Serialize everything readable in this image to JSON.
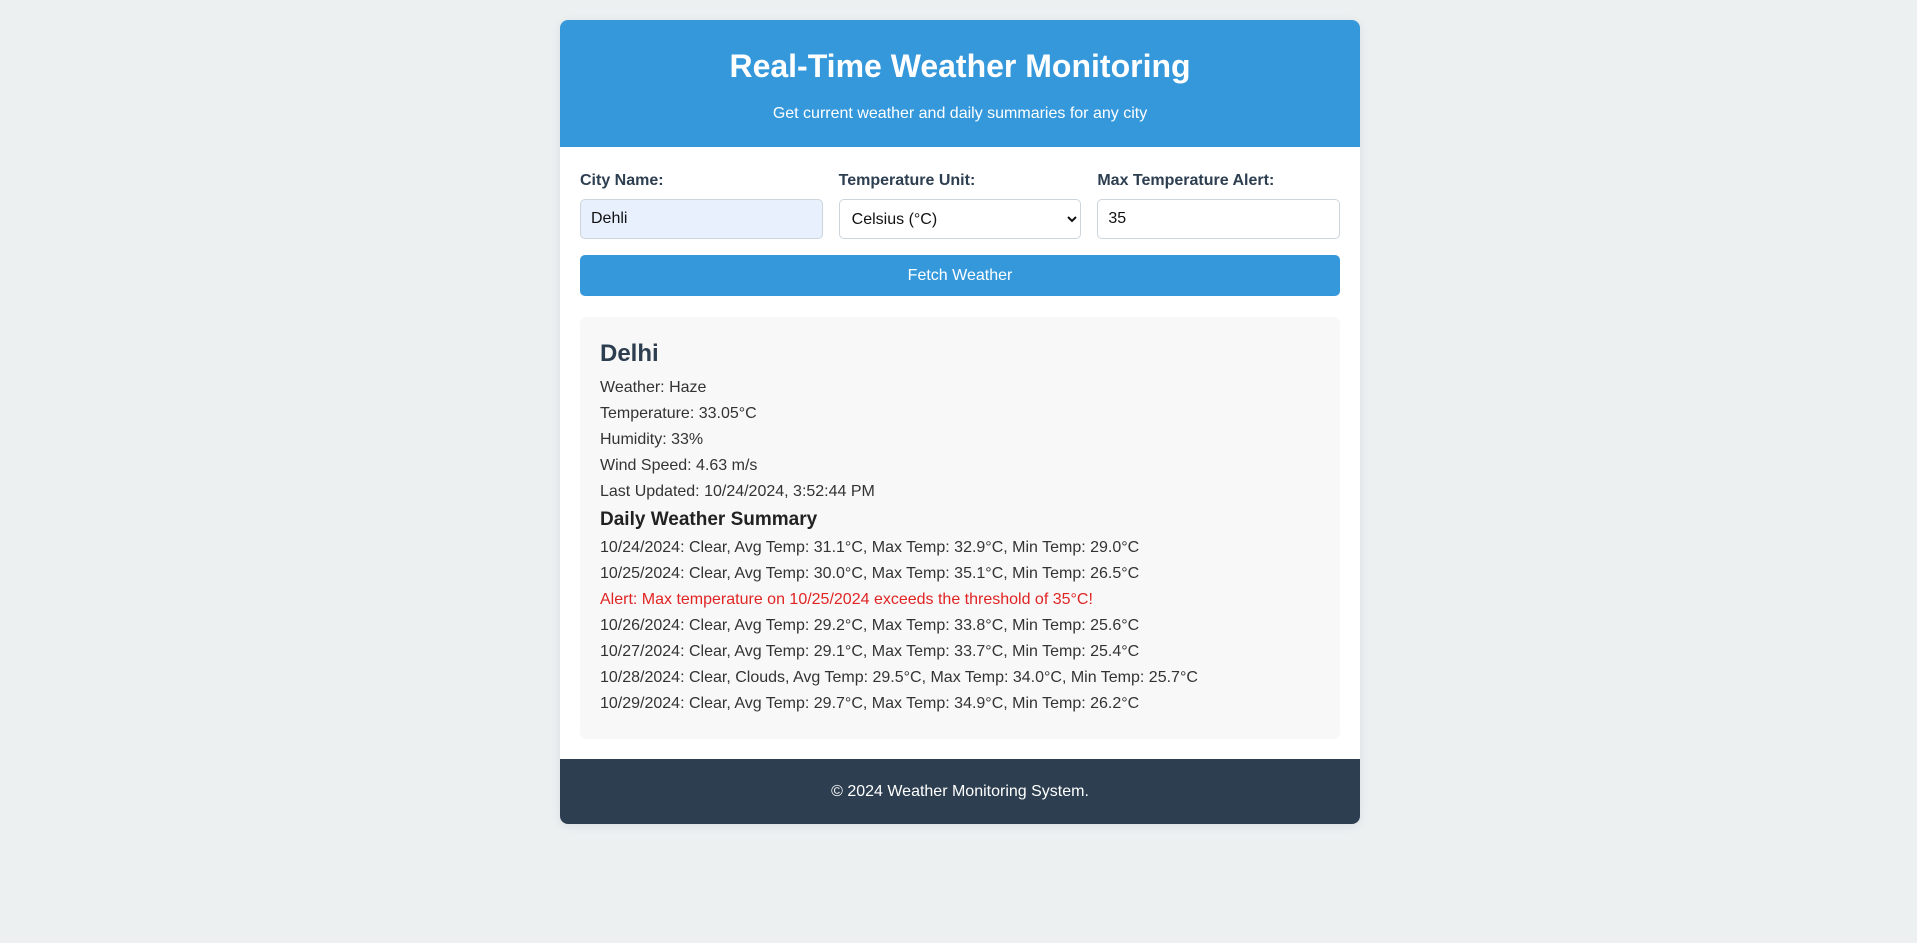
{
  "header": {
    "title": "Real-Time Weather Monitoring",
    "subtitle": "Get current weather and daily summaries for any city"
  },
  "form": {
    "city_label": "City Name:",
    "city_value": "Dehli",
    "unit_label": "Temperature Unit:",
    "unit_selected": "Celsius (°C)",
    "alert_label": "Max Temperature Alert:",
    "alert_value": "35",
    "fetch_label": "Fetch Weather"
  },
  "result": {
    "city": "Delhi",
    "weather": "Weather: Haze",
    "temperature": "Temperature: 33.05°C",
    "humidity": "Humidity: 33%",
    "wind": "Wind Speed: 4.63 m/s",
    "updated": "Last Updated: 10/24/2024, 3:52:44 PM",
    "summary_title": "Daily Weather Summary",
    "summary": [
      "10/24/2024: Clear, Avg Temp: 31.1°C, Max Temp: 32.9°C, Min Temp: 29.0°C",
      "10/25/2024: Clear, Avg Temp: 30.0°C, Max Temp: 35.1°C, Min Temp: 26.5°C",
      "Alert: Max temperature on 10/25/2024 exceeds the threshold of 35°C!",
      "10/26/2024: Clear, Avg Temp: 29.2°C, Max Temp: 33.8°C, Min Temp: 25.6°C",
      "10/27/2024: Clear, Avg Temp: 29.1°C, Max Temp: 33.7°C, Min Temp: 25.4°C",
      "10/28/2024: Clear, Clouds, Avg Temp: 29.5°C, Max Temp: 34.0°C, Min Temp: 25.7°C",
      "10/29/2024: Clear, Avg Temp: 29.7°C, Max Temp: 34.9°C, Min Temp: 26.2°C"
    ]
  },
  "footer": {
    "text": "© 2024 Weather Monitoring System."
  },
  "colors": {
    "accent": "#3498db",
    "footer_bg": "#2c3e50",
    "alert": "#e02424",
    "page_bg": "#ecf0f1"
  }
}
